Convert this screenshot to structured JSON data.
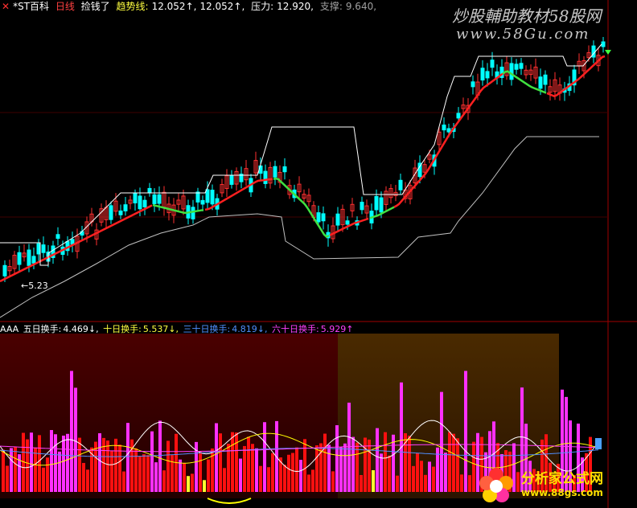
{
  "header": {
    "close_mark": "✕",
    "stock_name": "*ST百科",
    "period": "日线",
    "indicator_name": "捡钱了",
    "trend_label": "趋势线:",
    "trend_value": "12.052↑,",
    "trend_value2": "12.052↑,",
    "pressure_label": "压力:",
    "pressure_value": "12.920,",
    "support_label": "支撑:",
    "support_value": "9.640,"
  },
  "price_marker": "←5.23",
  "sub_header": {
    "indicator": "AAA",
    "ma5_label": "五日换手:",
    "ma5_value": "4.469↓,",
    "ma10_label": "十日换手:",
    "ma10_value": "5.537↓,",
    "ma30_label": "三十日换手:",
    "ma30_value": "4.819↓,",
    "ma60_label": "六十日换手:",
    "ma60_value": "5.929↑"
  },
  "watermark": {
    "line1": "炒股輔助教材58股网",
    "line2": "www.58Gu.com"
  },
  "logo": {
    "title": "分析家公式网",
    "url": "www.88gs.com"
  },
  "colors": {
    "up": "#ff3030",
    "down": "#00ffff",
    "trend_up": "#ff2020",
    "trend_down": "#40e040",
    "envelope": "#ffffff",
    "bar_magenta": "#ff30ff",
    "bar_red": "#ff1010",
    "bar_yellow": "#ffff30",
    "ma5": "#ffffff",
    "ma10": "#ffff00",
    "ma30": "#5090ff",
    "ma60": "#ff40ff",
    "bg_sub": "#3a0000",
    "bg_sub2": "#3a2000"
  }
}
